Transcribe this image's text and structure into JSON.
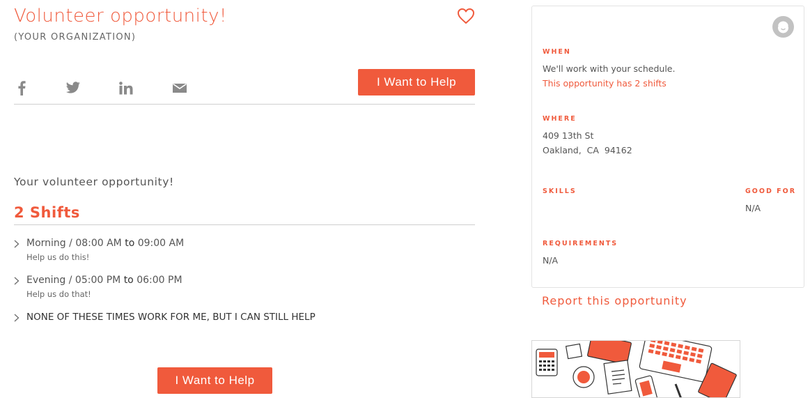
{
  "header": {
    "title": "Volunteer opportunity!",
    "organization": "(YOUR ORGANIZATION)"
  },
  "share": {
    "icons": [
      "facebook-icon",
      "twitter-icon",
      "linkedin-icon",
      "email-icon"
    ]
  },
  "cta": {
    "label": "I Want to Help"
  },
  "main": {
    "description": "Your volunteer opportunity!",
    "shifts_title": "2 Shifts",
    "shifts": [
      {
        "name": "Morning",
        "start": "08:00 AM",
        "sep": "to",
        "end": "09:00 AM",
        "note": "Help us do this!"
      },
      {
        "name": "Evening",
        "start": "05:00 PM",
        "sep": "to",
        "end": "06:00 PM",
        "note": "Help us do that!"
      }
    ],
    "no_times": "NONE OF THESE TIMES WORK FOR ME, BUT I CAN STILL HELP"
  },
  "panel": {
    "when_label": "WHEN",
    "when_text": "We'll work with your schedule.",
    "when_link": "This opportunity has 2 shifts",
    "where_label": "WHERE",
    "address_line1": "409 13th St",
    "address_city": "Oakland,",
    "address_state": "CA",
    "address_zip": "94162",
    "skills_label": "SKILLS",
    "good_for_label": "GOOD FOR",
    "good_for_value": "N/A",
    "requirements_label": "REQUIREMENTS",
    "requirements_value": "N/A"
  },
  "report": "Report this opportunity",
  "colors": {
    "accent": "#f05a3c",
    "text": "#555555",
    "rule": "#cfcfcf"
  }
}
